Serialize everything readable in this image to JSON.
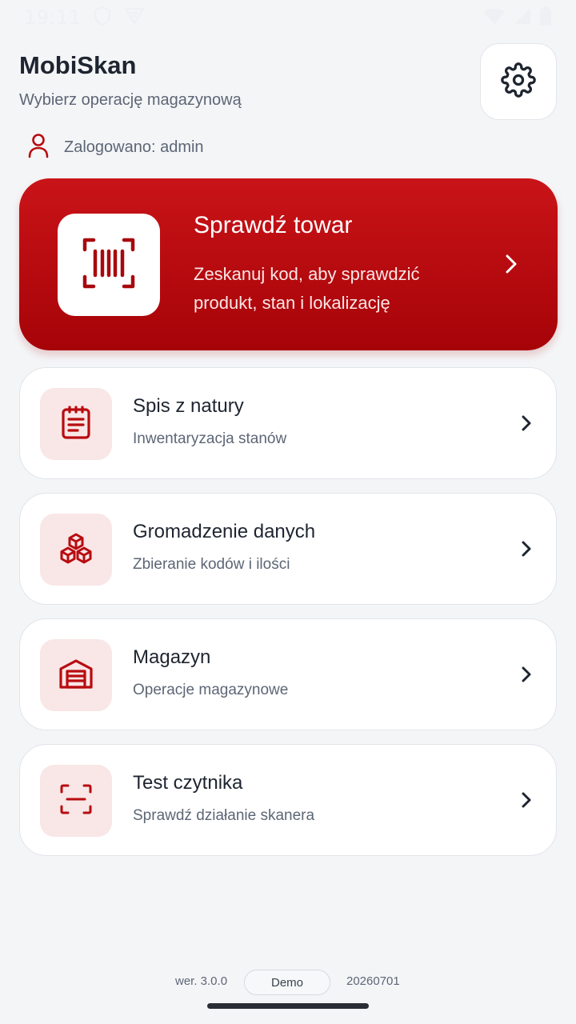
{
  "status_bar": {
    "time": "19:11",
    "icons_left": [
      "shield-icon",
      "notification-app-icon"
    ],
    "icons_right": [
      "wifi-icon",
      "signal-icon",
      "battery-icon"
    ]
  },
  "header": {
    "title": "MobiSkan",
    "subtitle": "Wybierz operację magazynową",
    "settings_icon": "gear-icon",
    "logged_in": "Zalogowano: admin"
  },
  "hero": {
    "title": "Sprawdź towar",
    "description": "Zeskanuj kod, aby sprawdzić produkt, stan i lokalizację",
    "icon": "barcode-scan-icon"
  },
  "menu": [
    {
      "title": "Spis z natury",
      "subtitle": "Inwentaryzacja stanów",
      "icon": "clipboard-list-icon"
    },
    {
      "title": "Gromadzenie danych",
      "subtitle": "Zbieranie kodów i ilości",
      "icon": "boxes-icon"
    },
    {
      "title": "Magazyn",
      "subtitle": "Operacje magazynowe",
      "icon": "warehouse-icon"
    },
    {
      "title": "Test czytnika",
      "subtitle": "Sprawdź działanie skanera",
      "icon": "scan-frame-icon"
    }
  ],
  "footer": {
    "version": "wer. 3.0.0",
    "badge": "Demo",
    "build": "20260701"
  },
  "colors": {
    "accent": "#b80c10",
    "accent_light": "#f9e6e6",
    "background": "#f4f5f7"
  }
}
